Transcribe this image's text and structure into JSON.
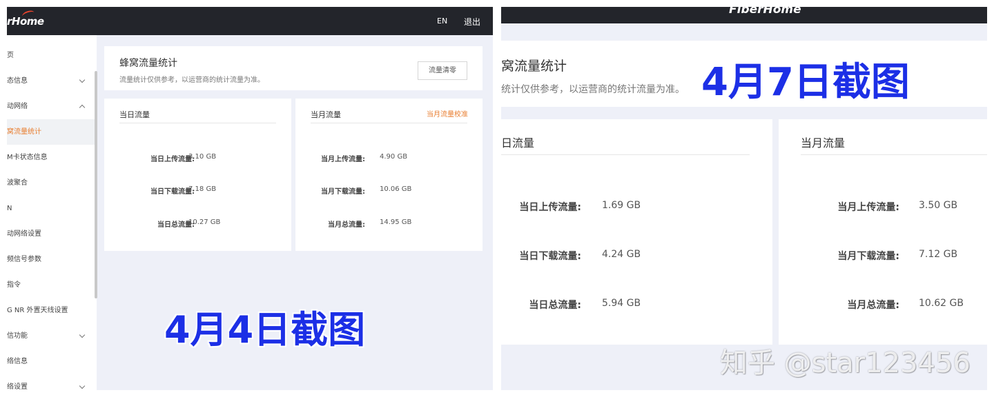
{
  "left": {
    "header": {
      "logo": "rHome",
      "lang": "EN",
      "logout": "退出"
    },
    "sidebar": [
      {
        "label": "页"
      },
      {
        "label": "态信息"
      },
      {
        "label": "动网络"
      },
      {
        "label": "窝流量统计"
      },
      {
        "label": "M卡状态信息"
      },
      {
        "label": "波聚合"
      },
      {
        "label": "N"
      },
      {
        "label": "动网络设置"
      },
      {
        "label": "频信号参数"
      },
      {
        "label": "指令"
      },
      {
        "label": "G NR 外置天线设置"
      },
      {
        "label": "信功能"
      },
      {
        "label": "络信息"
      },
      {
        "label": "络设置"
      }
    ],
    "page": {
      "title": "蜂窝流量统计",
      "subtitle": "流量统计仅供参考，以运营商的统计流量为准。",
      "clear_button": "流量清零"
    },
    "daily": {
      "heading": "当日流量",
      "upload_label": "当日上传流量:",
      "upload_value": "3.10 GB",
      "download_label": "当日下载流量:",
      "download_value": "7.18 GB",
      "total_label": "当日总流量:",
      "total_value": "10.27 GB"
    },
    "monthly": {
      "heading": "当月流量",
      "calibrate_link": "当月流量校准",
      "upload_label": "当月上传流量:",
      "upload_value": "4.90 GB",
      "download_label": "当月下载流量:",
      "download_value": "10.06 GB",
      "total_label": "当月总流量:",
      "total_value": "14.95 GB"
    },
    "stamp": "4月4日截图"
  },
  "right": {
    "header": {
      "logo": "FiberHome"
    },
    "page": {
      "title": "窝流量统计",
      "subtitle": "统计仅供参考，以运营商的统计流量为准。"
    },
    "daily": {
      "heading": "日流量",
      "upload_label": "当日上传流量:",
      "upload_value": "1.69 GB",
      "download_label": "当日下载流量:",
      "download_value": "4.24 GB",
      "total_label": "当日总流量:",
      "total_value": "5.94 GB"
    },
    "monthly": {
      "heading": "当月流量",
      "upload_label": "当月上传流量:",
      "upload_value": "3.50 GB",
      "download_label": "当月下载流量:",
      "download_value": "7.12 GB",
      "total_label": "当月总流量:",
      "total_value": "10.62 GB"
    },
    "stamp": "4月7日截图"
  },
  "watermark": "知乎 @star123456"
}
